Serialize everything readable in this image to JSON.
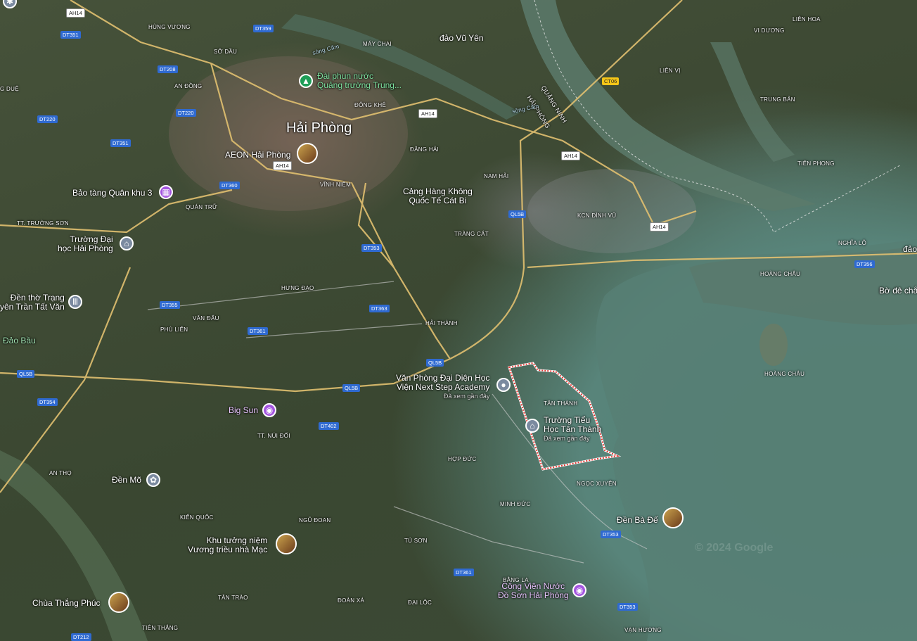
{
  "city": "Hải Phòng",
  "areas": [
    {
      "id": "hung-vuong",
      "text": "HÙNG VƯƠNG"
    },
    {
      "id": "so-dau",
      "text": "SỞ DẦU"
    },
    {
      "id": "may-chai",
      "text": "MÁY CHAI"
    },
    {
      "id": "an-dong",
      "text": "AN ĐỒNG"
    },
    {
      "id": "dong-khe",
      "text": "ĐÔNG KHÊ"
    },
    {
      "id": "dang-hai",
      "text": "ĐẰNG HẢI"
    },
    {
      "id": "nam-hai",
      "text": "NAM HẢI"
    },
    {
      "id": "vinh-niem",
      "text": "VĨNH NIỆM"
    },
    {
      "id": "quan-tru",
      "text": "QUÁN TRỮ"
    },
    {
      "id": "tt-truong-son",
      "text": "TT. TRƯỜNG SƠN"
    },
    {
      "id": "trang-cat",
      "text": "TRÀNG CÁT"
    },
    {
      "id": "hung-dao",
      "text": "HƯNG ĐẠO"
    },
    {
      "id": "van-dau",
      "text": "VĂN ĐẨU"
    },
    {
      "id": "phu-lien",
      "text": "PHÙ LIỄN"
    },
    {
      "id": "hai-thanh",
      "text": "HẢI THÀNH"
    },
    {
      "id": "tan-thanh",
      "text": "TÂN THÀNH"
    },
    {
      "id": "tt-nui-doi",
      "text": "TT. NÚI ĐỐI"
    },
    {
      "id": "hop-duc",
      "text": "HỢP ĐỨC"
    },
    {
      "id": "an-tho",
      "text": "AN THỌ"
    },
    {
      "id": "kien-quoc",
      "text": "KIẾN QUỐC"
    },
    {
      "id": "ngu-doan",
      "text": "NGŨ ĐOAN"
    },
    {
      "id": "minh-duc",
      "text": "MINH ĐỨC"
    },
    {
      "id": "ngoc-xuyen",
      "text": "NGỌC XUYÊN"
    },
    {
      "id": "tu-son",
      "text": "TÚ SƠN"
    },
    {
      "id": "bang-la",
      "text": "BẰNG LA"
    },
    {
      "id": "tan-trao",
      "text": "TÂN TRÀO"
    },
    {
      "id": "doan-xa",
      "text": "ĐOÀN XÁ"
    },
    {
      "id": "dai-loc",
      "text": "ĐẠI LỘC"
    },
    {
      "id": "tien-thang",
      "text": "TIÊN THẮNG"
    },
    {
      "id": "van-huong",
      "text": "VẠN HƯƠNG"
    },
    {
      "id": "vi-duong",
      "text": "VI DƯƠNG"
    },
    {
      "id": "lien-hoa",
      "text": "LIÊN HOA"
    },
    {
      "id": "lien-vi",
      "text": "LIÊN VỊ"
    },
    {
      "id": "trung-ban",
      "text": "TRUNG BẢN"
    },
    {
      "id": "tien-phong",
      "text": "TIÊN PHONG"
    },
    {
      "id": "kcn-dinh-vu",
      "text": "KCN ĐÌNH VŨ"
    },
    {
      "id": "nghia-lo",
      "text": "NGHĨA LỘ"
    },
    {
      "id": "hoang-chau-1",
      "text": "HOÀNG CHÂU"
    },
    {
      "id": "hoang-chau-2",
      "text": "HOÀNG CHÂU"
    },
    {
      "id": "dao-vu-yen",
      "text": "đảo Vũ Yên"
    },
    {
      "id": "dao-bau",
      "text": "Đảo Bầu"
    },
    {
      "id": "g-due",
      "text": "G DUỆ"
    },
    {
      "id": "quang-ninh",
      "text": "QUẢNG NINH"
    },
    {
      "id": "hai-phong-border",
      "text": "HẢI PHÒNG"
    },
    {
      "id": "song-cam-1",
      "text": "sông Cấm"
    },
    {
      "id": "song-cam-2",
      "text": "sông Cấm"
    },
    {
      "id": "dao-right",
      "text": "đảo"
    },
    {
      "id": "bo-de-cha",
      "text": "Bờ đê chắ"
    }
  ],
  "roads": [
    {
      "id": "ah14-top",
      "text": "AH14",
      "style": "white"
    },
    {
      "id": "dt351-a",
      "text": "DT351",
      "style": "blue"
    },
    {
      "id": "dt359",
      "text": "DT359",
      "style": "blue"
    },
    {
      "id": "dt208",
      "text": "DT208",
      "style": "blue"
    },
    {
      "id": "dt220-a",
      "text": "DT220",
      "style": "blue"
    },
    {
      "id": "dt220-b",
      "text": "DT220",
      "style": "blue"
    },
    {
      "id": "dt351-b",
      "text": "DT351",
      "style": "blue"
    },
    {
      "id": "ah14-b",
      "text": "AH14",
      "style": "white"
    },
    {
      "id": "ah14-c",
      "text": "AH14",
      "style": "white"
    },
    {
      "id": "ah14-d",
      "text": "AH14",
      "style": "white"
    },
    {
      "id": "ah14-e",
      "text": "AH14",
      "style": "white"
    },
    {
      "id": "dt360",
      "text": "DT360",
      "style": "blue"
    },
    {
      "id": "ql5b-a",
      "text": "QL5B",
      "style": "blue"
    },
    {
      "id": "ct06",
      "text": "CT06",
      "style": "yellow"
    },
    {
      "id": "dt353-a",
      "text": "DT353",
      "style": "blue"
    },
    {
      "id": "dt355",
      "text": "DT355",
      "style": "blue"
    },
    {
      "id": "dt363",
      "text": "DT363",
      "style": "blue"
    },
    {
      "id": "dt361-a",
      "text": "DT361",
      "style": "blue"
    },
    {
      "id": "ql5b-b",
      "text": "QL5B",
      "style": "blue"
    },
    {
      "id": "ql5b-c",
      "text": "QL5B",
      "style": "blue"
    },
    {
      "id": "ql5b-d",
      "text": "QL5B",
      "style": "blue"
    },
    {
      "id": "dt354",
      "text": "DT354",
      "style": "blue"
    },
    {
      "id": "dt402",
      "text": "DT402",
      "style": "blue"
    },
    {
      "id": "dt353-b",
      "text": "DT353",
      "style": "blue"
    },
    {
      "id": "dt361-b",
      "text": "DT361",
      "style": "blue"
    },
    {
      "id": "dt353-c",
      "text": "DT353",
      "style": "blue"
    },
    {
      "id": "dt212",
      "text": "DT212",
      "style": "blue"
    },
    {
      "id": "dt356",
      "text": "DT356",
      "style": "blue"
    }
  ],
  "pois": [
    {
      "id": "dai-phun-nuoc",
      "line1": "Đài phun nước",
      "line2": "Quảng trường Trung...",
      "icon": "tree-icon"
    },
    {
      "id": "aeon",
      "line1": "AEON Hải Phòng",
      "icon": "photo-thumb"
    },
    {
      "id": "bao-tang",
      "line1": "Bảo tàng Quân khu 3",
      "icon": "museum-icon"
    },
    {
      "id": "cang-hang-khong",
      "line1": "Cảng Hàng Không",
      "line2": "Quốc Tế Cát Bi",
      "icon": ""
    },
    {
      "id": "truong-dai-hoc",
      "line1": "Trường Đại",
      "line2": "học Hải Phòng",
      "icon": "school-icon"
    },
    {
      "id": "den-tho",
      "line1": "Đền thờ Trạng",
      "line2": "yên Trần Tất Văn",
      "icon": "temple-icon"
    },
    {
      "id": "van-phong",
      "line1": "Văn Phòng Đại Diện Học",
      "line2": "Viện Next Step Academy",
      "line3": "Đã xem gần đây",
      "icon": "pin-icon"
    },
    {
      "id": "truong-tieu-hoc",
      "line1": "Trường Tiểu",
      "line2": "Học Tân Thành",
      "line3": "Đã xem gần đây",
      "icon": "school-icon"
    },
    {
      "id": "big-sun",
      "line1": "Big Sun",
      "icon": "camera-icon"
    },
    {
      "id": "den-mo",
      "line1": "Đền Mõ",
      "icon": "temple-icon"
    },
    {
      "id": "den-ba-de",
      "line1": "Đền Bà Đế",
      "icon": "photo-thumb"
    },
    {
      "id": "khu-tuong-niem",
      "line1": "Khu tưởng niệm",
      "line2": "Vương triều nhà Mạc",
      "icon": "photo-thumb"
    },
    {
      "id": "cong-vien-nuoc",
      "line1": "Công Viên Nước",
      "line2": "Đồ Sơn Hải Phòng",
      "icon": "camera-icon"
    },
    {
      "id": "chua-thang-phuc",
      "line1": "Chùa Thắng Phúc",
      "icon": "photo-thumb"
    }
  ],
  "copyright": "© 2024 Google"
}
